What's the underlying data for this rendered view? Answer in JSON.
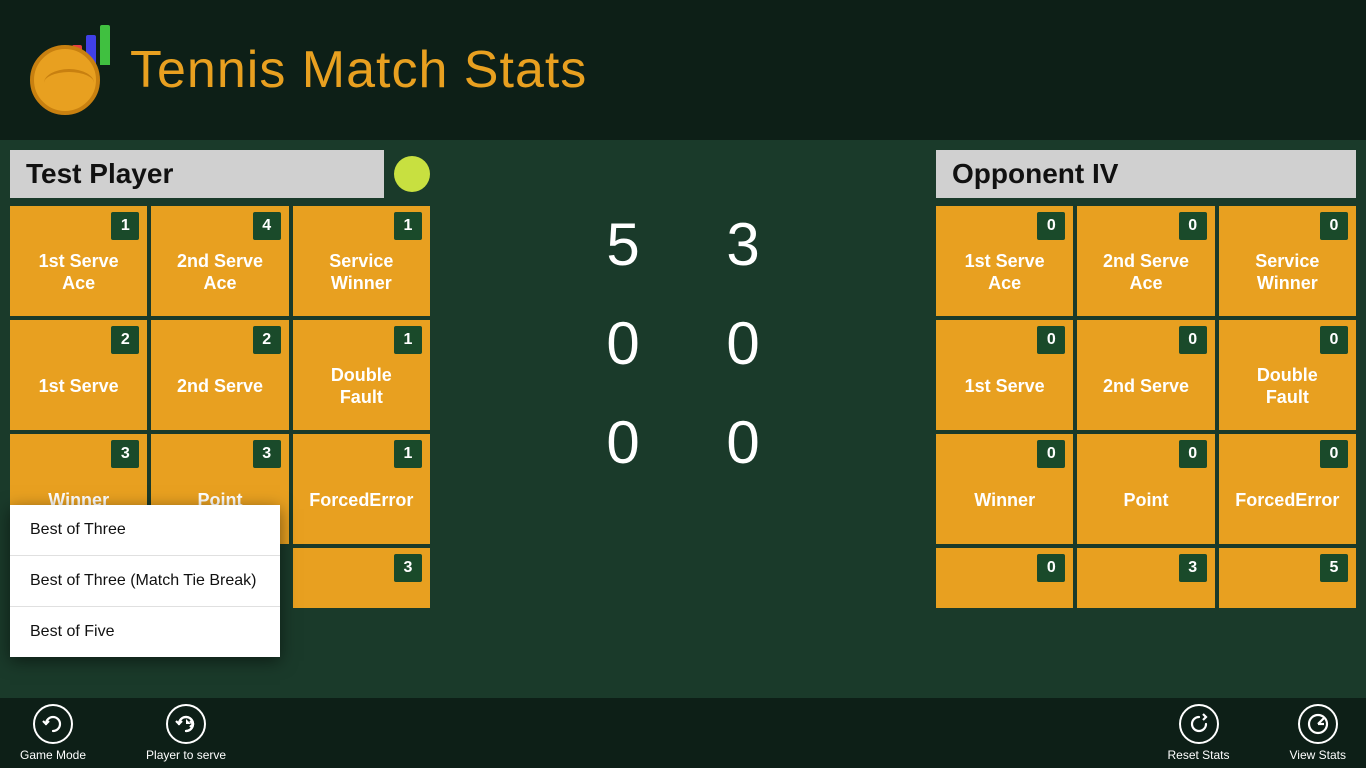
{
  "app": {
    "title": "Tennis Match Stats"
  },
  "header": {
    "title": "Tennis Match Stats"
  },
  "player1": {
    "name": "Test Player",
    "has_serve": true,
    "stats": [
      {
        "label": "1st Serve\nAce",
        "count": 1,
        "id": "1st-serve-ace"
      },
      {
        "label": "2nd Serve\nAce",
        "count": 4,
        "id": "2nd-serve-ace"
      },
      {
        "label": "Service\nWinner",
        "count": 1,
        "id": "service-winner"
      },
      {
        "label": "1st Serve",
        "count": 2,
        "id": "1st-serve"
      },
      {
        "label": "2nd Serve",
        "count": 2,
        "id": "2nd-serve"
      },
      {
        "label": "Double\nFault",
        "count": 1,
        "id": "double-fault"
      },
      {
        "label": "Winner",
        "count": 3,
        "id": "winner"
      },
      {
        "label": "Point",
        "count": 3,
        "id": "point"
      },
      {
        "label": "ForcedError",
        "count": 1,
        "id": "forced-error"
      },
      {
        "label": "",
        "count": 3,
        "id": "extra"
      }
    ]
  },
  "player2": {
    "name": "Opponent IV",
    "has_serve": false,
    "stats": [
      {
        "label": "1st Serve\nAce",
        "count": 0,
        "id": "1st-serve-ace"
      },
      {
        "label": "2nd Serve\nAce",
        "count": 0,
        "id": "2nd-serve-ace"
      },
      {
        "label": "Service\nWinner",
        "count": 0,
        "id": "service-winner"
      },
      {
        "label": "1st Serve",
        "count": 0,
        "id": "1st-serve"
      },
      {
        "label": "2nd Serve",
        "count": 0,
        "id": "2nd-serve"
      },
      {
        "label": "Double\nFault",
        "count": 0,
        "id": "double-fault"
      },
      {
        "label": "Winner",
        "count": 0,
        "id": "winner"
      },
      {
        "label": "Point",
        "count": 0,
        "id": "point"
      },
      {
        "label": "ForcedError",
        "count": 0,
        "id": "forced-error"
      },
      {
        "label": "",
        "count": 0,
        "id": "extra1"
      },
      {
        "label": "",
        "count": 3,
        "id": "extra2"
      },
      {
        "label": "",
        "count": 5,
        "id": "extra3"
      }
    ]
  },
  "scores": [
    {
      "p1": "5",
      "p2": "3"
    },
    {
      "p1": "0",
      "p2": "0"
    },
    {
      "p1": "0",
      "p2": "0"
    }
  ],
  "bottom": {
    "game_mode_label": "Game Mode",
    "player_serve_label": "Player to serve",
    "reset_stats_label": "Reset Stats",
    "view_stats_label": "View Stats"
  },
  "dropdown": {
    "items": [
      "Best of Three",
      "Best of Three (Match Tie Break)",
      "Best of Five"
    ]
  }
}
